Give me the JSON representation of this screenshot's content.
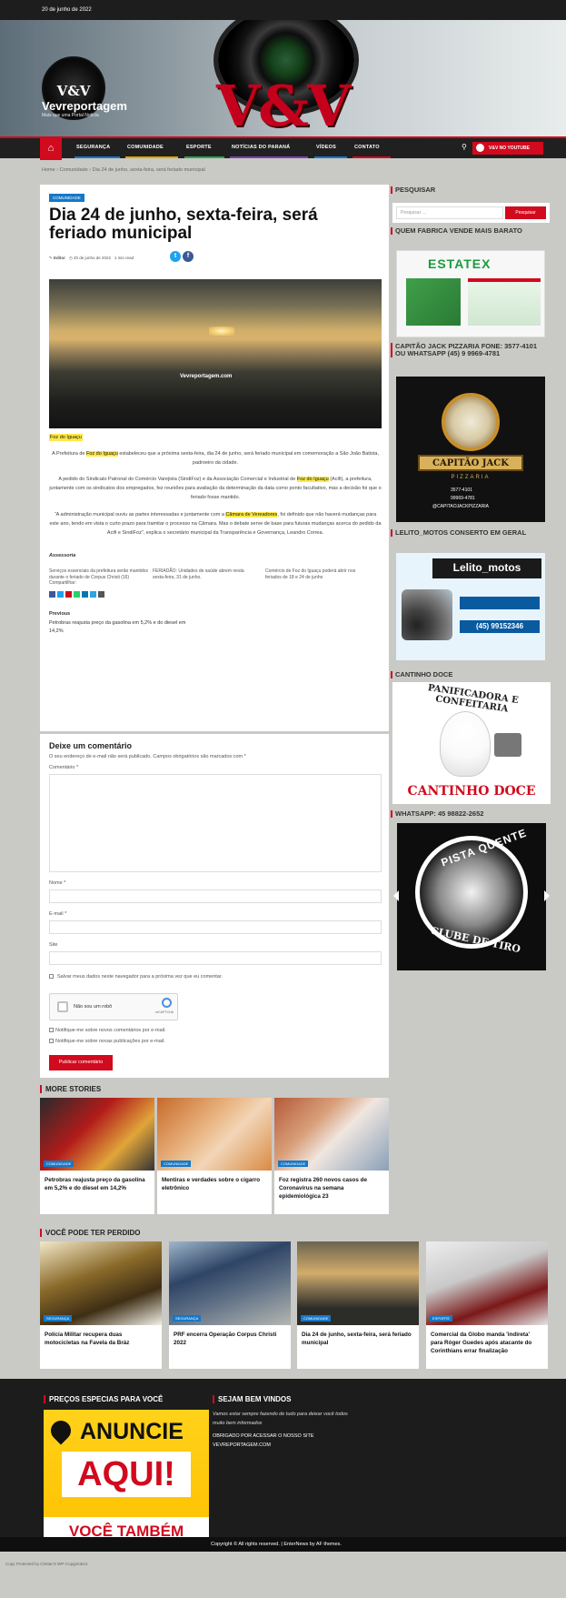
{
  "topbar": {
    "date": "20 de junho de 2022"
  },
  "header": {
    "logo_text": "V&V",
    "site_title": "Vevreportagem",
    "tagline": "Mais que uma Portal Notícia",
    "hero_text": "V&V"
  },
  "nav": {
    "items": [
      "SEGURANÇA",
      "COMUNIDADE",
      "ESPORTE",
      "NOTÍCIAS DO PARANÁ",
      "VÍDEOS",
      "CONTATO"
    ],
    "youtube_label": "V&V NO YOUTUBE"
  },
  "breadcrumb": {
    "home": "Home",
    "category": "Comunidade",
    "current": "Dia 24 de junho, sexta-feira, será feriado municipal"
  },
  "article": {
    "category": "COMUNIDADE",
    "title": "Dia 24 de junho, sexta-feira, será feriado municipal",
    "author": "Editor",
    "date": "20 de junho de 2022",
    "read_time": "1 min read",
    "image_watermark": "Vevreportagem.com",
    "caption": "Foz do Iguaçu",
    "p1_pre": "A Prefeitura de ",
    "p1_hl": "Foz do Iguaçu",
    "p1_post": " estabeleceu que a próxima sexta-feira, dia 24 de junho, será feriado municipal em comemoração a São João Batista, padroeiro da cidade.",
    "p2_pre": "A pedido do Sindicato Patronal do Comércio Varejista (SindiFoz) e da Associação Comercial e Industrial de ",
    "p2_hl": "Foz do Iguaçu",
    "p2_post": " (Acifi), a prefeitura, juntamente com os sindicatos dos empregados, fez reuniões para avaliação da determinação da data como ponto facultativo, mas a decisão foi que o feriado fosse mantido.",
    "p3_pre": "“A administração municipal ouviu as partes interessadas e juntamente com a ",
    "p3_hl": "Câmara de Vereadores",
    "p3_post": ", foi definido que não haverá mudanças para este ano, tendo em vista o curto prazo para tramitar o processo na Câmara. Mas o debate serve de base para futuras mudanças acerca do pedido da Acifi e SindiFoz”, explica o secretário municipal da Transparência e Governança, Leandro Correa.",
    "source": "Assessoria",
    "related": [
      "Serviços essenciais da prefeitura serão mantidos durante o feriado de Corpus Christi (16)",
      "FERIADÃO: Unidades de saúde abrem nesta sexta-feira, 31 de junho.",
      "Comércio de Foz do Iguaçu poderá abrir nos feriados de 18 e 24 de junho"
    ],
    "share_label": "Compartilhar:",
    "prev_label": "Previous",
    "prev_title": "Petrobras reajusta preço da gasolina em 5,2% e do diesel em 14,2%"
  },
  "comment_form": {
    "title": "Deixe um comentário",
    "note": "O seu endereço de e-mail não será publicado. Campos obrigatórios são marcados com *",
    "comment_label": "Comentário *",
    "name_label": "Nome *",
    "email_label": "E-mail *",
    "site_label": "Site",
    "save_label": "Salvar meus dados neste navegador para a próxima vez que eu comentar.",
    "captcha_label": "Não sou um robô",
    "captcha_brand": "reCAPTCHA",
    "notify1": "Notifique-me sobre novos comentários por e-mail.",
    "notify2": "Notifique-me sobre novas publicações por e-mail.",
    "submit": "Publicar comentário"
  },
  "more_stories": {
    "title": "MORE STORIES",
    "cards": [
      {
        "cat": "COMUNIDADE",
        "title": "Petrobras reajusta preço da gasolina em 5,2% e do diesel em 14,2%"
      },
      {
        "cat": "COMUNIDADE",
        "title": "Mentiras e verdades sobre o cigarro eletrônico"
      },
      {
        "cat": "COMUNIDADE",
        "title": "Foz registra 260 novos casos de Coronavírus na semana epidemiológica 23"
      }
    ]
  },
  "missed": {
    "title": "VOCÊ PODE TER PERDIDO",
    "cards": [
      {
        "cat": "SEGURANÇA",
        "title": "Polícia Militar recupera duas motocicletas na Favela da Bráz"
      },
      {
        "cat": "SEGURANÇA",
        "title": "PRF encerra Operação Corpus Christi 2022"
      },
      {
        "cat": "COMUNIDADE",
        "title": "Dia 24 de junho, sexta-feira, será feriado municipal"
      },
      {
        "cat": "ESPORTE",
        "title": "Comercial da Globo manda 'indireta' para Róger Guedes após atacante do Corinthians errar finalização"
      }
    ]
  },
  "sidebar": {
    "search_title": "PESQUISAR",
    "search_placeholder": "Pesquisar …",
    "search_button": "Pesquisar",
    "ad1_title": "QUEM FABRICA VENDE MAIS BARATO",
    "ad1_brand": "ESTATEX",
    "ad2_title": "CAPITÃO JACK PIZZARIA FONE: 3577-4101 OU WHATSAPP (45) 9 9969-4781",
    "ad2_brand": "CAPITÃO JACK",
    "ad2_sub": "PIZZARIA",
    "ad2_phone1": "3577-4101",
    "ad2_phone2": "99969-4781",
    "ad2_handle": "@CAPITAOJACKPIZZARIA",
    "ad3_title": "LELITO_MOTOS CONSERTO EM GERAL",
    "ad3_brand": "Lelito_motos",
    "ad3_phone": "(45) 99152346",
    "ad4_title": "CANTINHO DOCE",
    "ad4_text": "PANIFICADORA E CONFEITARIA",
    "ad4_brand": "CANTINHO DOCE",
    "ad5_title": "WHATSAPP: 45 98822-2652",
    "ad5_brand": "PISTA QUENTE",
    "ad5_sub": "CLUBE DE TIRO"
  },
  "footer": {
    "col1_title": "PREÇOS ESPECIAS PARA VOCÊ",
    "ad_line1": "ANUNCIE",
    "ad_line2": "AQUI!",
    "ad_line3": "VOCÊ TAMBÉM",
    "col2_title": "SEJAM BEM VINDOS",
    "col2_text": "Vamos estar sempre fazendo de tudo para deixar você todos muito bem informados",
    "col2_text2": "OBRIGADO POR ACESSAR O NOSSO SITE VEVREPORTAGEM.COM",
    "copyright": "Copyright © All rights reserved. | EnterNews by AF themes.",
    "bottom_note": "Copy Protected by Chetan's WP-Copyprotect."
  },
  "colors": {
    "accent": "#d10a1e",
    "badge": "#1578c8",
    "highlight": "#ffe94a"
  }
}
